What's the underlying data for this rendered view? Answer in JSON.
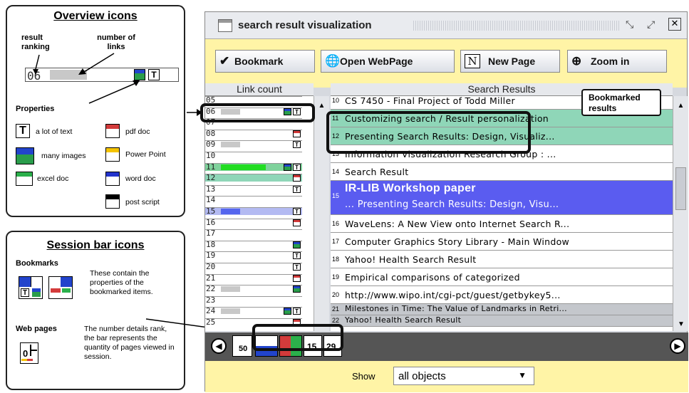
{
  "overview": {
    "title": "Overview icons",
    "result_ranking": "result ranking",
    "number_of_links": "number of links",
    "sample_rank": "06",
    "properties": "Properties",
    "items": [
      {
        "label": "a lot of text",
        "icon": "text-icon"
      },
      {
        "label": "pdf doc",
        "icon": "pdf-icon",
        "color": "#d33b3b"
      },
      {
        "label": "many images",
        "icon": "images-icon"
      },
      {
        "label": "Power Point",
        "icon": "powerpoint-icon",
        "color": "#f5c400"
      },
      {
        "label": "excel doc",
        "icon": "excel-icon",
        "color": "#2bb04b"
      },
      {
        "label": "word doc",
        "icon": "word-icon",
        "color": "#2233cc"
      },
      {
        "label": "post script",
        "icon": "postscript-icon",
        "color": "#000000"
      }
    ]
  },
  "session": {
    "title": "Session bar icons",
    "bookmarks_label": "Bookmarks",
    "bookmarks_desc": "These contain the properties of the bookmarked items.",
    "webpages_label": "Web pages",
    "webpages_desc": "The number details rank, the bar represents the quantity of pages viewed in session."
  },
  "window": {
    "title": "search result visualization",
    "toolbar": {
      "bookmark": "Bookmark",
      "open": "Open WebPage",
      "new_page": "New Page",
      "zoom": "Zoom in"
    },
    "link_count_header": "Link count",
    "results_header": "Search Results",
    "bookmarked_callout": "Bookmarked results",
    "link_rows": [
      {
        "n": "05",
        "bar": 0,
        "mk": ""
      },
      {
        "n": "06",
        "bar": 0.3,
        "mk": "img-text"
      },
      {
        "n": "07",
        "bar": 0,
        "mk": ""
      },
      {
        "n": "08",
        "bar": 0,
        "mk": "pdf"
      },
      {
        "n": "09",
        "bar": 0.3,
        "mk": "text"
      },
      {
        "n": "10",
        "bar": 0,
        "mk": ""
      },
      {
        "n": "11",
        "bar": 0.7,
        "mk": "img-text",
        "hl": "green"
      },
      {
        "n": "12",
        "bar": 0,
        "mk": "pdf",
        "hl": "teal"
      },
      {
        "n": "13",
        "bar": 0,
        "mk": "text"
      },
      {
        "n": "14",
        "bar": 0,
        "mk": ""
      },
      {
        "n": "15",
        "bar": 0.3,
        "mk": "text",
        "hl": "blue"
      },
      {
        "n": "16",
        "bar": 0,
        "mk": "pdf"
      },
      {
        "n": "17",
        "bar": 0,
        "mk": ""
      },
      {
        "n": "18",
        "bar": 0,
        "mk": "img"
      },
      {
        "n": "19",
        "bar": 0,
        "mk": "text"
      },
      {
        "n": "20",
        "bar": 0,
        "mk": "text"
      },
      {
        "n": "21",
        "bar": 0,
        "mk": "pdf"
      },
      {
        "n": "22",
        "bar": 0.3,
        "mk": "img"
      },
      {
        "n": "23",
        "bar": 0,
        "mk": ""
      },
      {
        "n": "24",
        "bar": 0.3,
        "mk": "img-text"
      },
      {
        "n": "25",
        "bar": 0,
        "mk": "pdf"
      }
    ],
    "results": [
      {
        "n": "10",
        "t": "CS 7450 - Final Project of Todd Miller"
      },
      {
        "n": "11",
        "t": "Customizing search / Result personalization",
        "hl": "teal"
      },
      {
        "n": "12",
        "t": "Presenting Search Results: Design, Visualiz...",
        "hl": "teal"
      },
      {
        "n": "13",
        "t": "Information Visualization Research Group : ..."
      },
      {
        "n": "14",
        "t": "Search Result"
      },
      {
        "n": "15",
        "t": "IR-LIB Workshop paper",
        "sub": "... Presenting Search Results: Design, Visu...",
        "hl": "blue"
      },
      {
        "n": "16",
        "t": "WaveLens: A New View onto Internet Search R..."
      },
      {
        "n": "17",
        "t": "Computer Graphics Story Library - Main Window"
      },
      {
        "n": "18",
        "t": "Yahoo! Health Search Result"
      },
      {
        "n": "19",
        "t": "Empirical comparisons of categorized"
      },
      {
        "n": "20",
        "t": "http://www.wipo.int/cgi-pct/guest/getbykey5..."
      },
      {
        "n": "21",
        "t": "Milestones in Time: The Value of Landmarks in Retri...",
        "hl": "gray"
      },
      {
        "n": "22",
        "t": "Yahoo! Health Search Result",
        "hl": "gray"
      }
    ],
    "session_items": [
      "50",
      "15",
      "29"
    ],
    "show_label": "Show",
    "show_value": "all objects"
  }
}
